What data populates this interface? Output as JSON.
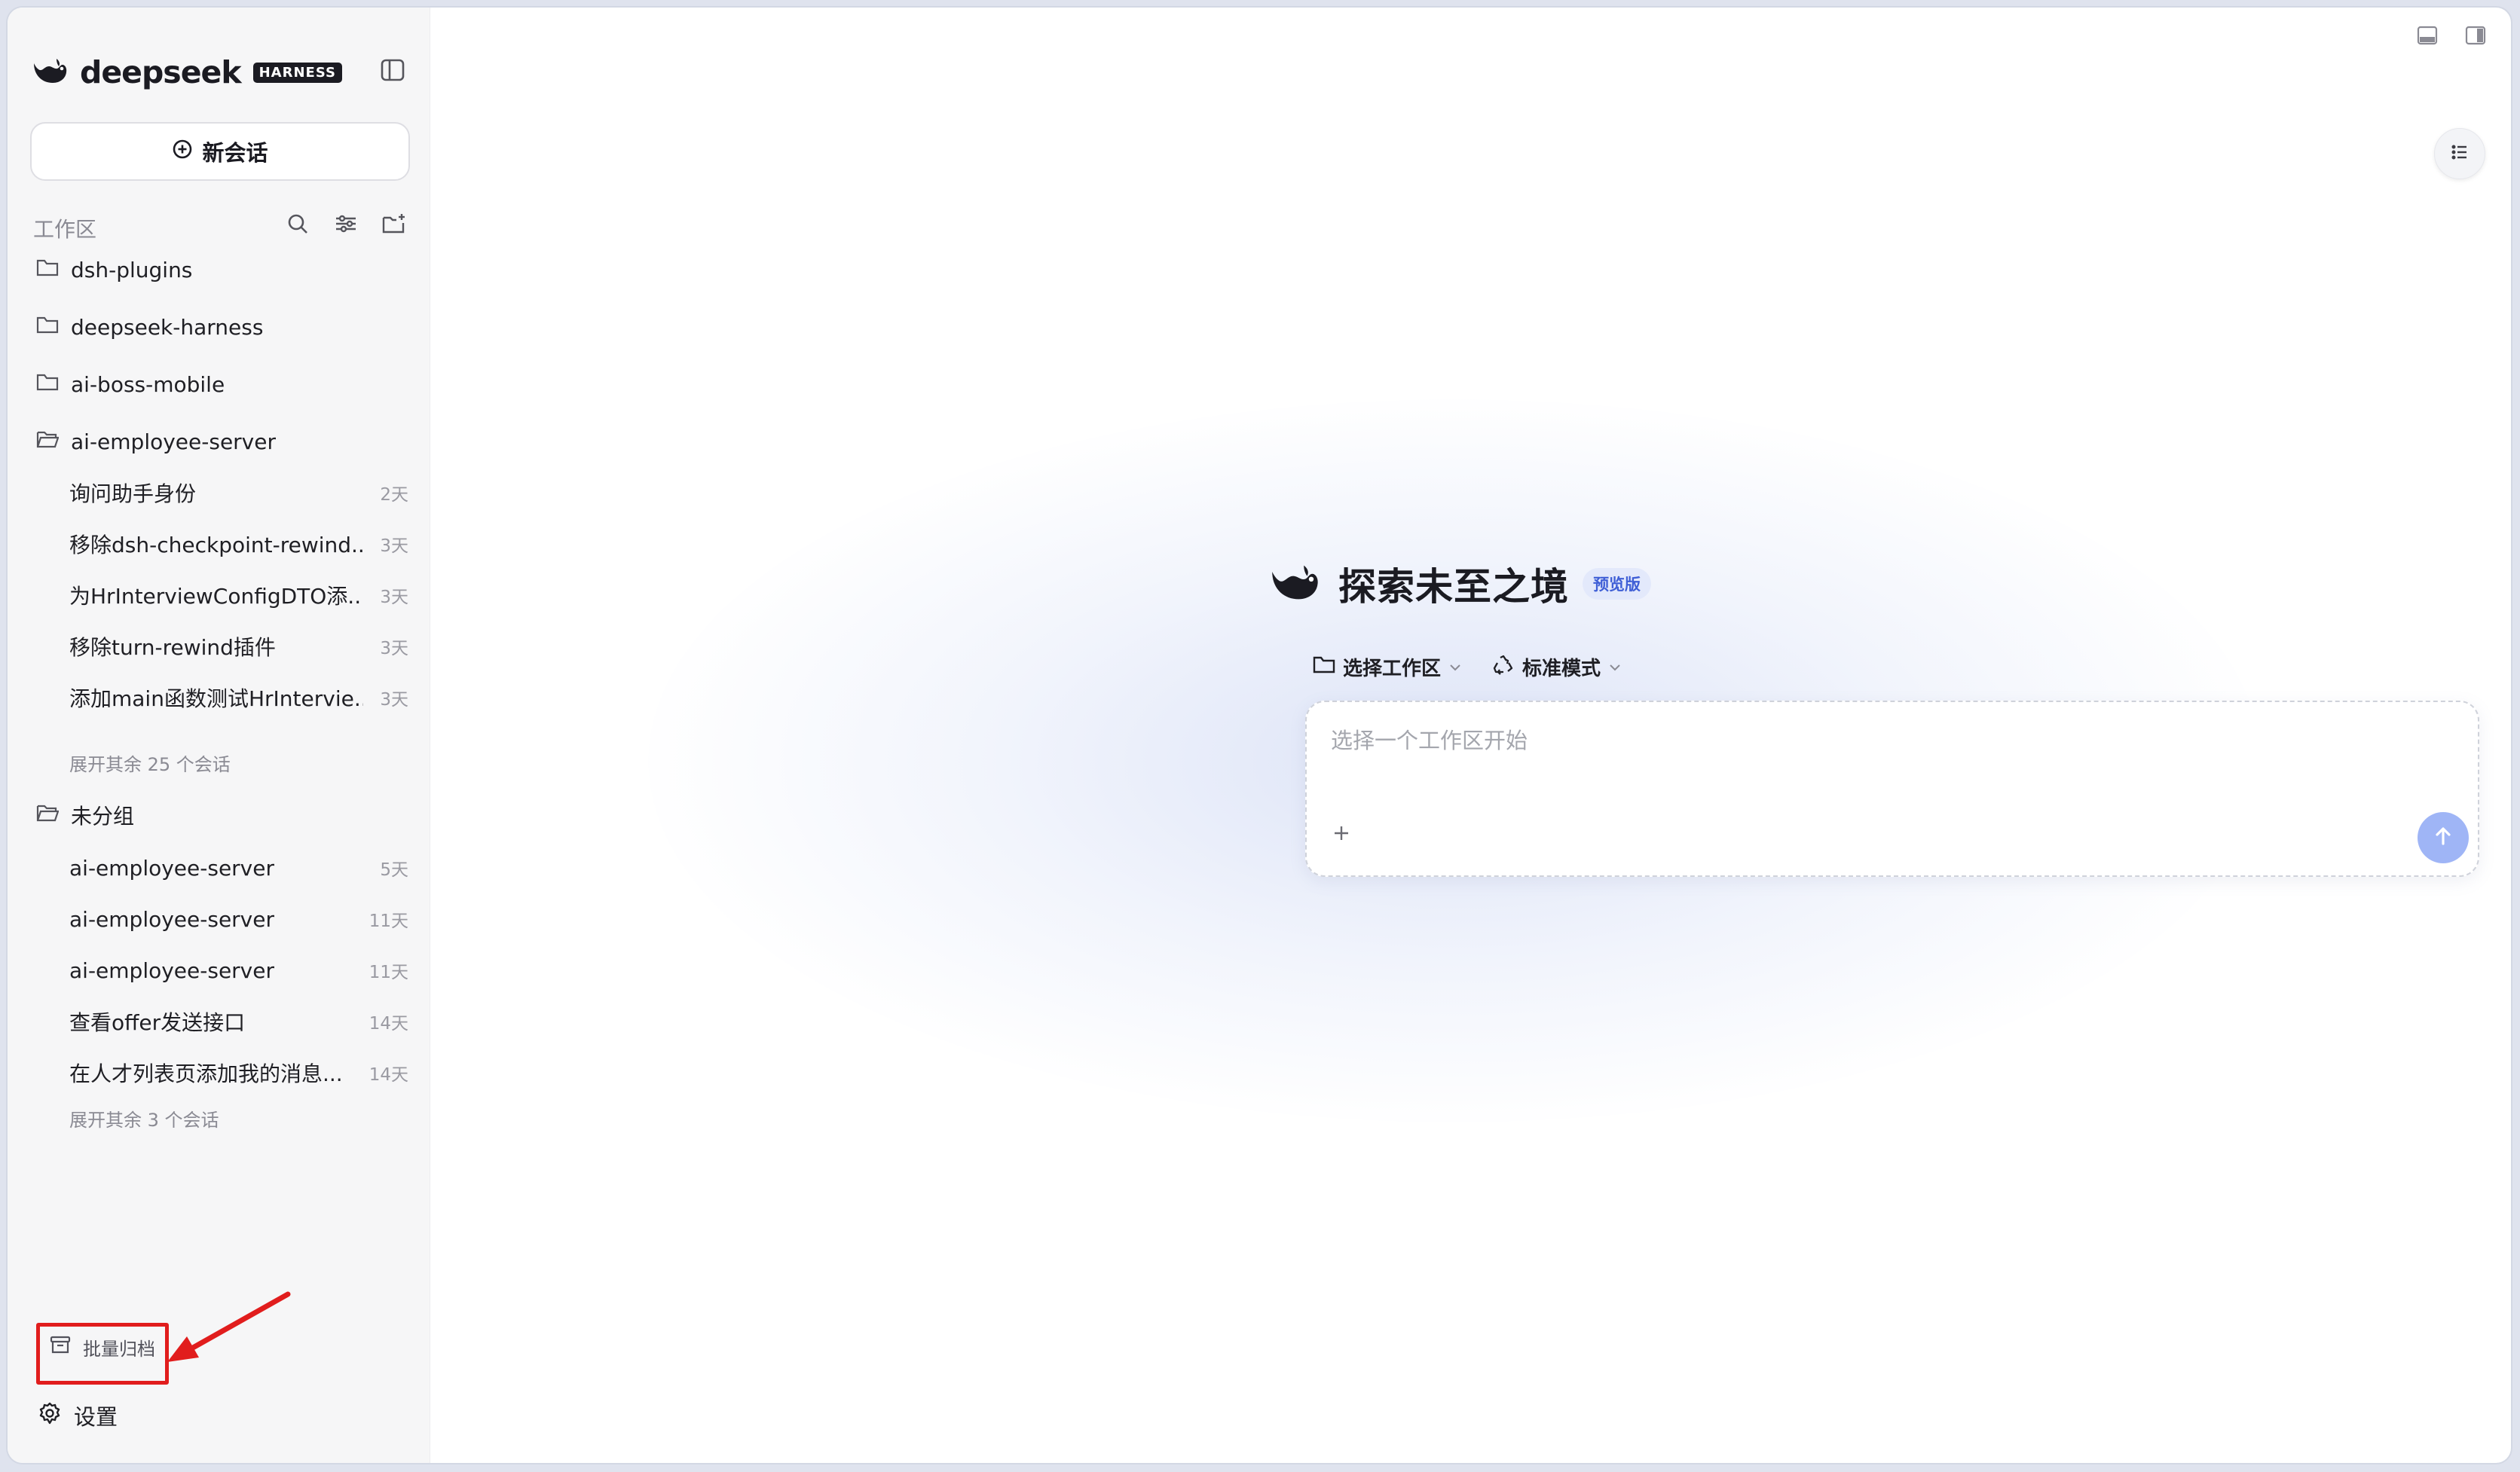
{
  "sidebar": {
    "brand": {
      "wordmark": "deepseek",
      "tag": "HARNESS"
    },
    "new_chat_label": "新会话",
    "workspace_title": "工作区",
    "folders": [
      {
        "name": "dsh-plugins"
      },
      {
        "name": "deepseek-harness"
      },
      {
        "name": "ai-boss-mobile"
      },
      {
        "name": "ai-employee-server"
      }
    ],
    "group1_sessions": [
      {
        "title": "询问助手身份",
        "age": "2天"
      },
      {
        "title": "移除dsh-checkpoint-rewind...",
        "age": "3天"
      },
      {
        "title": "为HrInterviewConfigDTO添...",
        "age": "3天"
      },
      {
        "title": "移除turn-rewind插件",
        "age": "3天"
      },
      {
        "title": "添加main函数测试HrIntervie...",
        "age": "3天"
      }
    ],
    "group1_more": "展开其余 25 个会话",
    "ungrouped_label": "未分组",
    "group2_sessions": [
      {
        "title": "ai-employee-server",
        "age": "5天"
      },
      {
        "title": "ai-employee-server",
        "age": "11天"
      },
      {
        "title": "ai-employee-server",
        "age": "11天"
      },
      {
        "title": "查看offer发送接口",
        "age": "14天"
      },
      {
        "title": "在人才列表页添加我的消息...",
        "age": "14天"
      }
    ],
    "group2_more": "展开其余 3 个会话",
    "archive_label": "批量归档",
    "settings_label": "设置"
  },
  "main": {
    "hero_title": "探索未至之境",
    "hero_badge": "预览版",
    "workspace_selector": "选择工作区",
    "mode_selector": "标准模式",
    "composer_placeholder": "选择一个工作区开始"
  },
  "colors": {
    "accent": "#3f5fd6",
    "send_button": "#9fb5f6",
    "annotation": "#e11d1d",
    "sidebar_bg": "#f6f6f7"
  }
}
